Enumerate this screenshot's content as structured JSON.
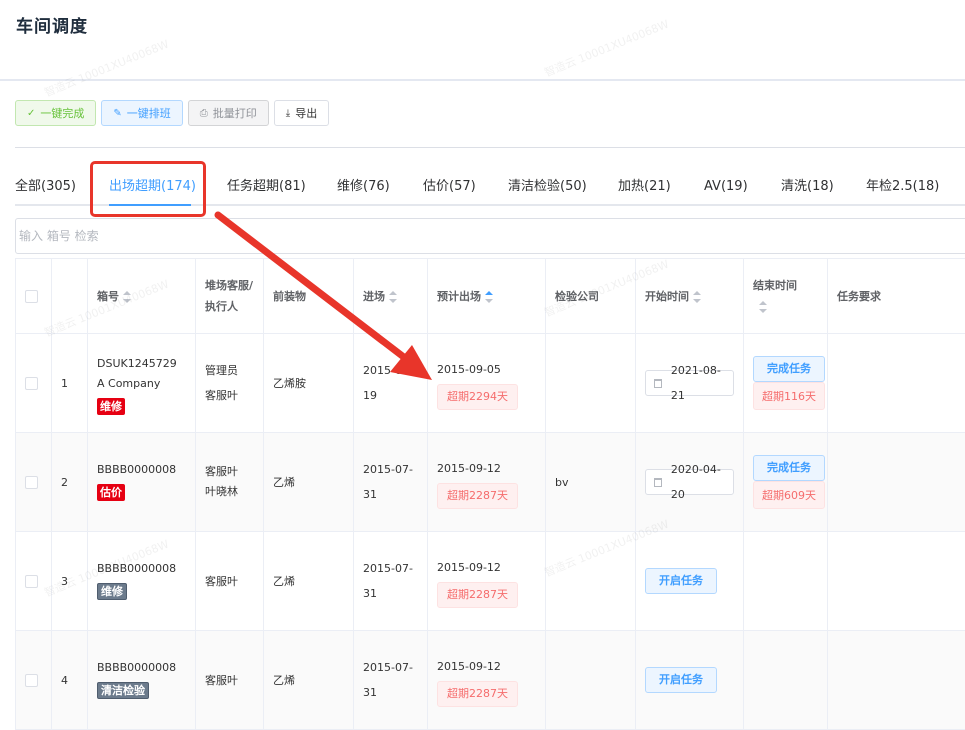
{
  "page": {
    "title": "车间调度"
  },
  "toolbar": {
    "complete_all": "一键完成",
    "schedule_all": "一键排班",
    "batch_print": "批量打印",
    "export": "导出"
  },
  "tabs": [
    {
      "label": "全部(305)"
    },
    {
      "label": "出场超期(174)"
    },
    {
      "label": "任务超期(81)"
    },
    {
      "label": "维修(76)"
    },
    {
      "label": "估价(57)"
    },
    {
      "label": "清洁检验(50)"
    },
    {
      "label": "加热(21)"
    },
    {
      "label": "AV(19)"
    },
    {
      "label": "清洗(18)"
    },
    {
      "label": "年检2.5(18)"
    }
  ],
  "search": {
    "placeholder": "输入 箱号 检索"
  },
  "table": {
    "headers": {
      "box_no": "箱号",
      "service": "堆场客服/执行人",
      "cargo": "前装物",
      "entry": "进场",
      "expected_exit": "预计出场",
      "inspection": "检验公司",
      "start_time": "开始时间",
      "end_time": "结束时间",
      "requirement": "任务要求"
    },
    "rows": [
      {
        "index": "1",
        "box_no": "DSUK1245729",
        "company": "A Company",
        "tag": "维修",
        "service_1": "管理员",
        "service_2": "客服叶",
        "cargo": "乙烯胺",
        "entry_1": "2015-0",
        "entry_2": "19",
        "exit_date": "2015-09-05",
        "exit_overdue": "超期2294天",
        "inspection": "",
        "start_date": "2021-08-21",
        "task_btn": "完成任务",
        "end_overdue": "超期116天"
      },
      {
        "index": "2",
        "box_no": "BBBB0000008",
        "tag": "估价",
        "service_1": "客服叶",
        "service_2": "叶晓林",
        "cargo": "乙烯",
        "entry_1": "2015-07-",
        "entry_2": "31",
        "exit_date": "2015-09-12",
        "exit_overdue": "超期2287天",
        "inspection": "bv",
        "start_date": "2020-04-20",
        "task_btn": "完成任务",
        "end_overdue": "超期609天"
      },
      {
        "index": "3",
        "box_no": "BBBB0000008",
        "tag": "维修",
        "service_1": "客服叶",
        "cargo": "乙烯",
        "entry_1": "2015-07-",
        "entry_2": "31",
        "exit_date": "2015-09-12",
        "exit_overdue": "超期2287天",
        "inspection": "",
        "task_btn": "开启任务"
      },
      {
        "index": "4",
        "box_no": "BBBB0000008",
        "tag": "清洁检验",
        "service_1": "客服叶",
        "cargo": "乙烯",
        "entry_1": "2015-07-",
        "entry_2": "31",
        "exit_date": "2015-09-12",
        "exit_overdue": "超期2287天",
        "inspection": "",
        "task_btn": "开启任务"
      }
    ]
  },
  "icons": {
    "complete": "check-icon",
    "schedule": "edit-icon",
    "print": "printer-icon",
    "export": "download-icon",
    "calendar": "calendar-icon"
  },
  "colors": {
    "accent": "#409eff",
    "annotation": "#e8352a",
    "danger_tag": "#e60012",
    "overdue_text": "#f56c6c"
  },
  "watermark": "智造云 10001XU40068W"
}
